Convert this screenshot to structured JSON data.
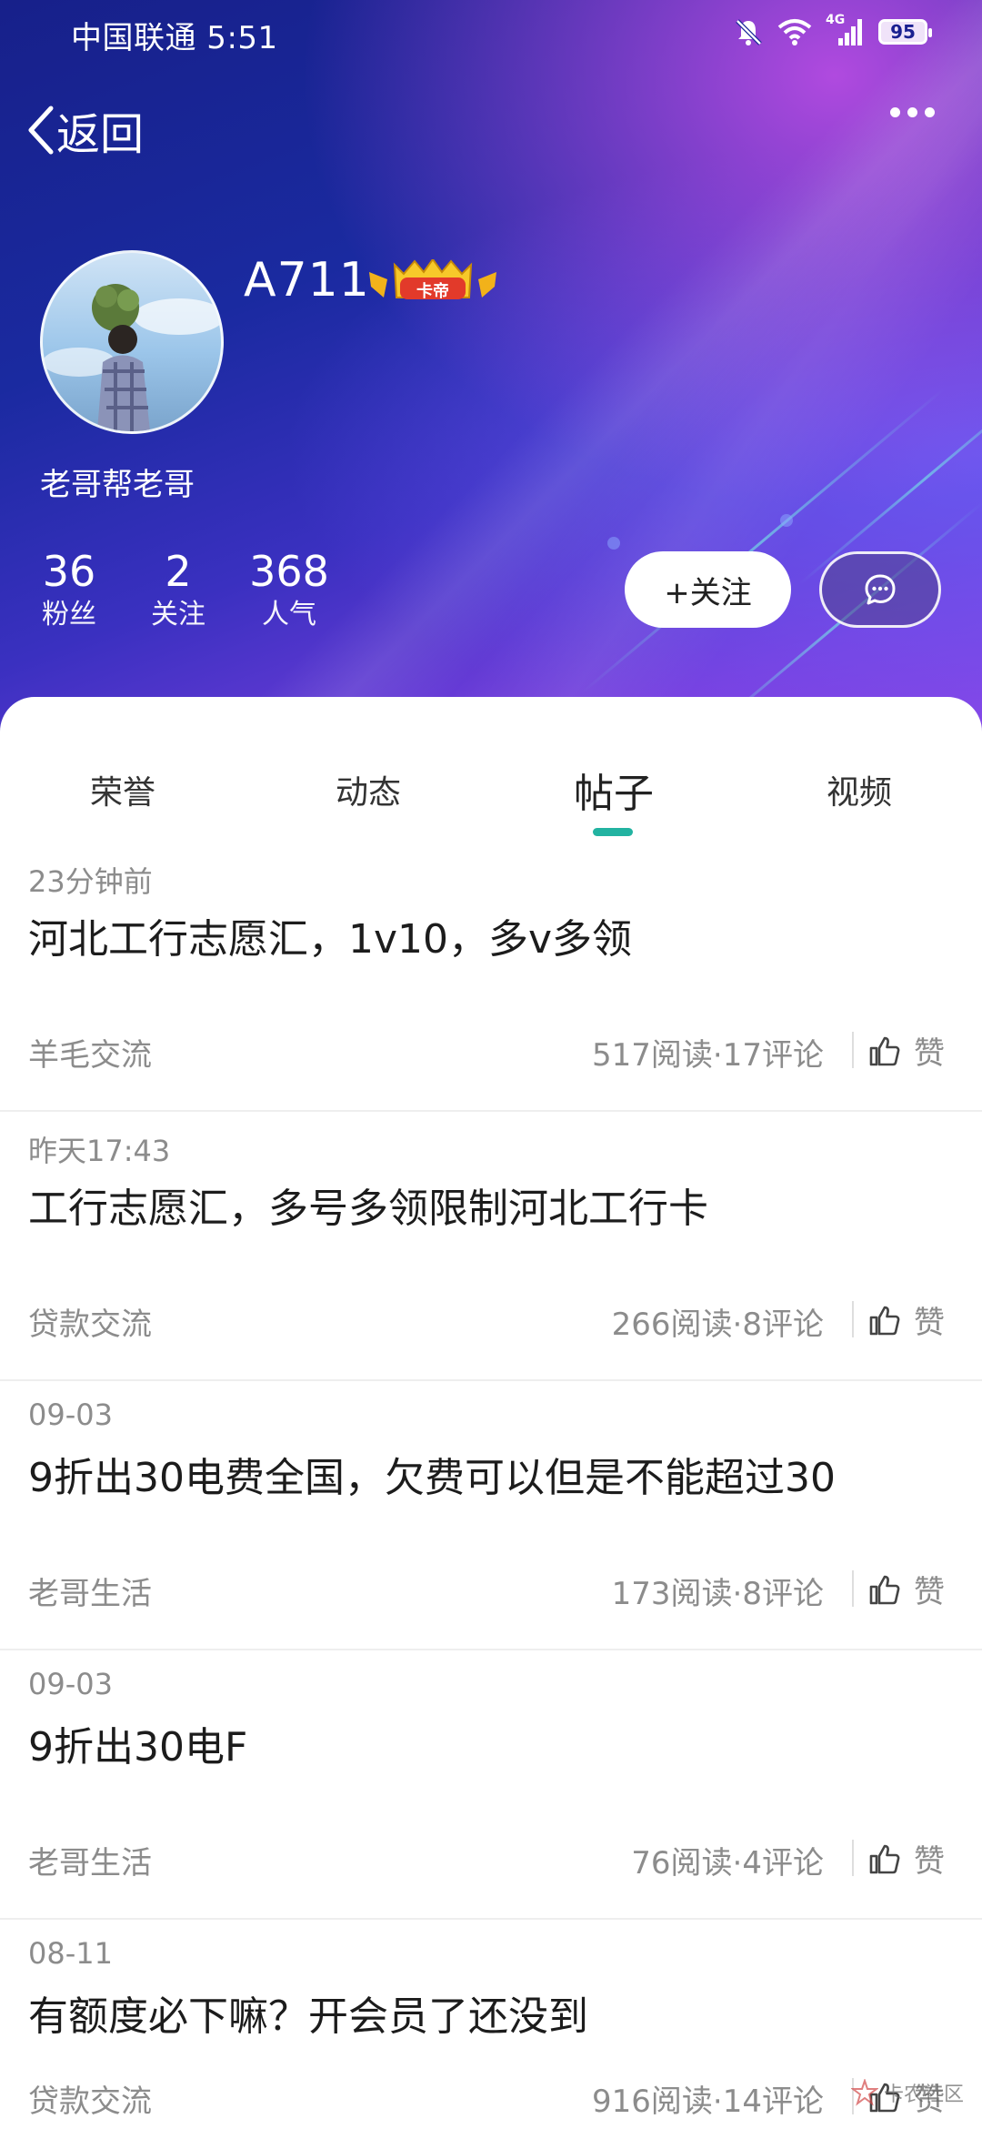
{
  "status_bar": {
    "carrier_time": "中国联通 5:51",
    "network_label": "4G",
    "battery": "95",
    "icons": [
      "mute-icon",
      "wifi-icon",
      "signal-icon",
      "battery-icon"
    ]
  },
  "nav": {
    "back_label": "返回",
    "back_icon": "chevron-left-icon",
    "more_icon": "more-icon"
  },
  "profile": {
    "username": "A711",
    "badge_label": "卡帝",
    "signature": "老哥帮老哥",
    "stats": [
      {
        "value": "36",
        "label": "粉丝"
      },
      {
        "value": "2",
        "label": "关注"
      },
      {
        "value": "368",
        "label": "人气"
      }
    ],
    "follow_label": "+关注",
    "message_icon": "chat-bubble-icon"
  },
  "tabs": [
    {
      "label": "荣誉",
      "active": false
    },
    {
      "label": "动态",
      "active": false
    },
    {
      "label": "帖子",
      "active": true
    },
    {
      "label": "视频",
      "active": false
    }
  ],
  "posts": [
    {
      "time": "23分钟前",
      "title": "河北工行志愿汇，1v10，多v多领",
      "category": "羊毛交流",
      "counts": "517阅读·17评论",
      "like_label": "赞"
    },
    {
      "time": "昨天17:43",
      "title": "工行志愿汇，多号多领限制河北工行卡",
      "category": "贷款交流",
      "counts": "266阅读·8评论",
      "like_label": "赞"
    },
    {
      "time": "09-03",
      "title": "9折出30电费全国，欠费可以但是不能超过30",
      "category": "老哥生活",
      "counts": "173阅读·8评论",
      "like_label": "赞"
    },
    {
      "time": "09-03",
      "title": "9折出30电F",
      "category": "老哥生活",
      "counts": "76阅读·4评论",
      "like_label": "赞"
    },
    {
      "time": "08-11",
      "title": "有额度必下嘛？开会员了还没到",
      "category": "贷款交流",
      "counts": "916阅读·14评论",
      "like_label": "赞"
    }
  ],
  "watermark": "卡农社区",
  "colors": {
    "accent": "#22b3a1",
    "header_dark": "#17208a",
    "header_light": "#8c46e8"
  }
}
